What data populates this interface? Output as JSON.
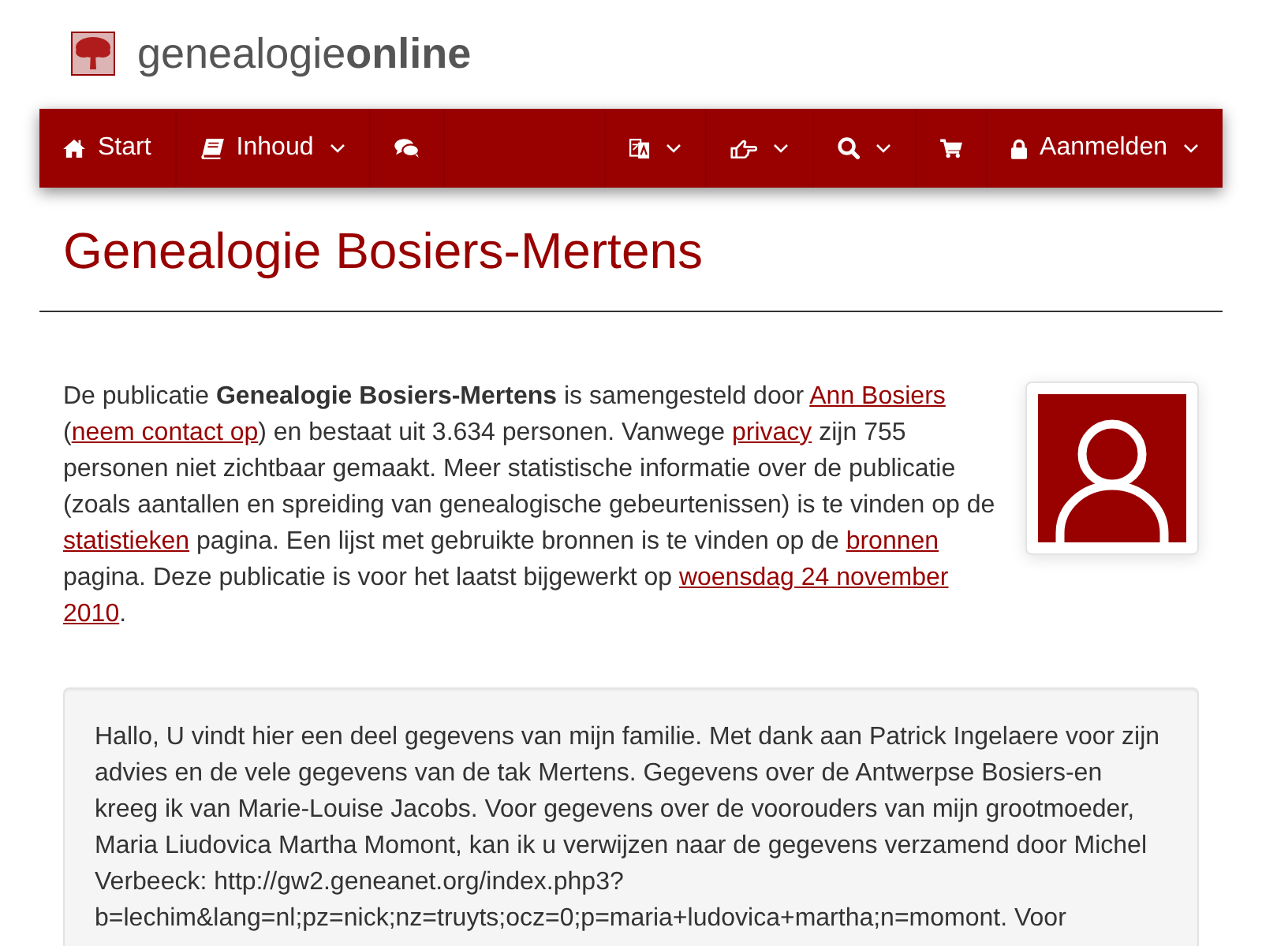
{
  "logo": {
    "text": "genealogie**online**"
  },
  "nav": {
    "left": [
      {
        "label": "Start",
        "dropdown": false
      },
      {
        "label": "Inhoud",
        "dropdown": true
      },
      {
        "dropdown": false
      }
    ],
    "right": [
      {
        "dropdown": true
      },
      {
        "dropdown": true
      },
      {
        "dropdown": true
      },
      {
        "dropdown": false
      },
      {
        "label": "Aanmelden",
        "dropdown": true
      }
    ]
  },
  "title": "Genealogie Bosiers-Mertens",
  "intro": [
    {
      "kind": "text",
      "text": "De publicatie "
    },
    {
      "kind": "bold",
      "text": "Genealogie Bosiers-Mertens"
    },
    {
      "kind": "text",
      "text": " is samengesteld door "
    },
    {
      "kind": "link",
      "parts": [
        "Ann Bosiers"
      ]
    },
    {
      "kind": "text",
      "text": " ("
    },
    {
      "kind": "link",
      "parts": [
        "neem contact op"
      ]
    },
    {
      "kind": "text",
      "text": ") en bestaat uit 3.634 personen. Vanwege "
    },
    {
      "kind": "link",
      "parts": [
        "privacy"
      ]
    },
    {
      "kind": "text",
      "text": " zijn 755 personen niet zichtbaar gemaakt. Meer statistische informatie over de publicatie (zoals aantallen en spreiding van genealogische gebeurtenissen) is te vinden op de "
    },
    {
      "kind": "link",
      "parts": [
        "statistieken"
      ]
    },
    {
      "kind": "text",
      "text": " pagina. Een lijst met gebruikte bronnen is te vinden op de "
    },
    {
      "kind": "link",
      "parts": [
        "bronnen"
      ]
    },
    {
      "kind": "text",
      "text": " pagina. Deze publicatie is voor het laatst bijgewerkt op "
    },
    {
      "kind": "link",
      "parts": [
        "woensdag 24 november",
        "2010"
      ]
    },
    {
      "kind": "text",
      "text": "."
    }
  ],
  "description": "Hallo, U vindt hier een deel gegevens van mijn familie. Met dank aan Patrick Ingelaere voor zijn advies en de vele gegevens van de tak Mertens. Gegevens over de Antwerpse Bosiers-en kreeg ik van Marie-Louise Jacobs. Voor gegevens over de voorouders van mijn grootmoeder, Maria Liudovica Martha Momont, kan ik u verwijzen naar de gegevens verzamend door Michel Verbeeck: http://gw2.geneanet.org/index.php3?b=lechim&lang=nl;pz=nick;nz=truyts;ocz=0;p=maria+ludovica+martha;n=momont. Voor"
}
